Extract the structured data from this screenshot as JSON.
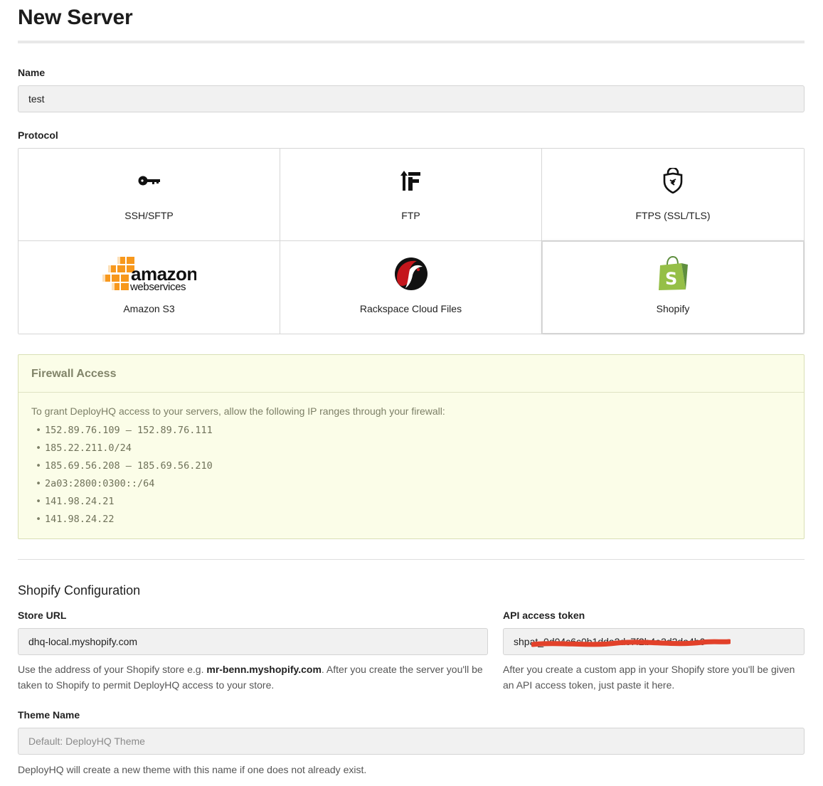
{
  "page": {
    "title": "New Server"
  },
  "name_field": {
    "label": "Name",
    "value": "test"
  },
  "protocol": {
    "label": "Protocol",
    "options": [
      {
        "label": "SSH/SFTP",
        "icon": "key-icon"
      },
      {
        "label": "FTP",
        "icon": "ftp-arrow-icon"
      },
      {
        "label": "FTPS (SSL/TLS)",
        "icon": "shield-icon"
      },
      {
        "label": "Amazon S3",
        "icon": "amazon-web-services-logo"
      },
      {
        "label": "Rackspace Cloud Files",
        "icon": "rackspace-logo"
      },
      {
        "label": "Shopify",
        "icon": "shopify-bag-logo"
      }
    ],
    "selected": "Shopify"
  },
  "firewall": {
    "title": "Firewall Access",
    "intro": "To grant DeployHQ access to your servers, allow the following IP ranges through your firewall:",
    "ranges": [
      "152.89.76.109 – 152.89.76.111",
      "185.22.211.0/24",
      "185.69.56.208 – 185.69.56.210",
      "2a03:2800:0300::/64",
      "141.98.24.21",
      "141.98.24.22"
    ]
  },
  "shopify": {
    "heading": "Shopify Configuration",
    "store_url": {
      "label": "Store URL",
      "value": "dhq-local.myshopify.com",
      "help_before": "Use the address of your Shopify store e.g. ",
      "help_example": "mr-benn.myshopify.com",
      "help_after": ". After you create the server you'll be taken to Shopify to permit DeployHQ access to your store."
    },
    "api_token": {
      "label": "API access token",
      "value": "shpat_0d04c6c0b1dda2dc7f2b4e3d2da4b0",
      "help": "After you create a custom app in your Shopify store you'll be given an API access token, just paste it here."
    },
    "theme_name": {
      "label": "Theme Name",
      "placeholder": "Default: DeployHQ Theme",
      "help": "DeployHQ will create a new theme with this name if one does not already exist."
    }
  },
  "colors": {
    "amazon_orange": "#f7981d",
    "rackspace_red": "#c4161c",
    "shopify_green": "#95bf47",
    "redaction": "#e2412a",
    "firewall_bg": "#fbfde8"
  }
}
